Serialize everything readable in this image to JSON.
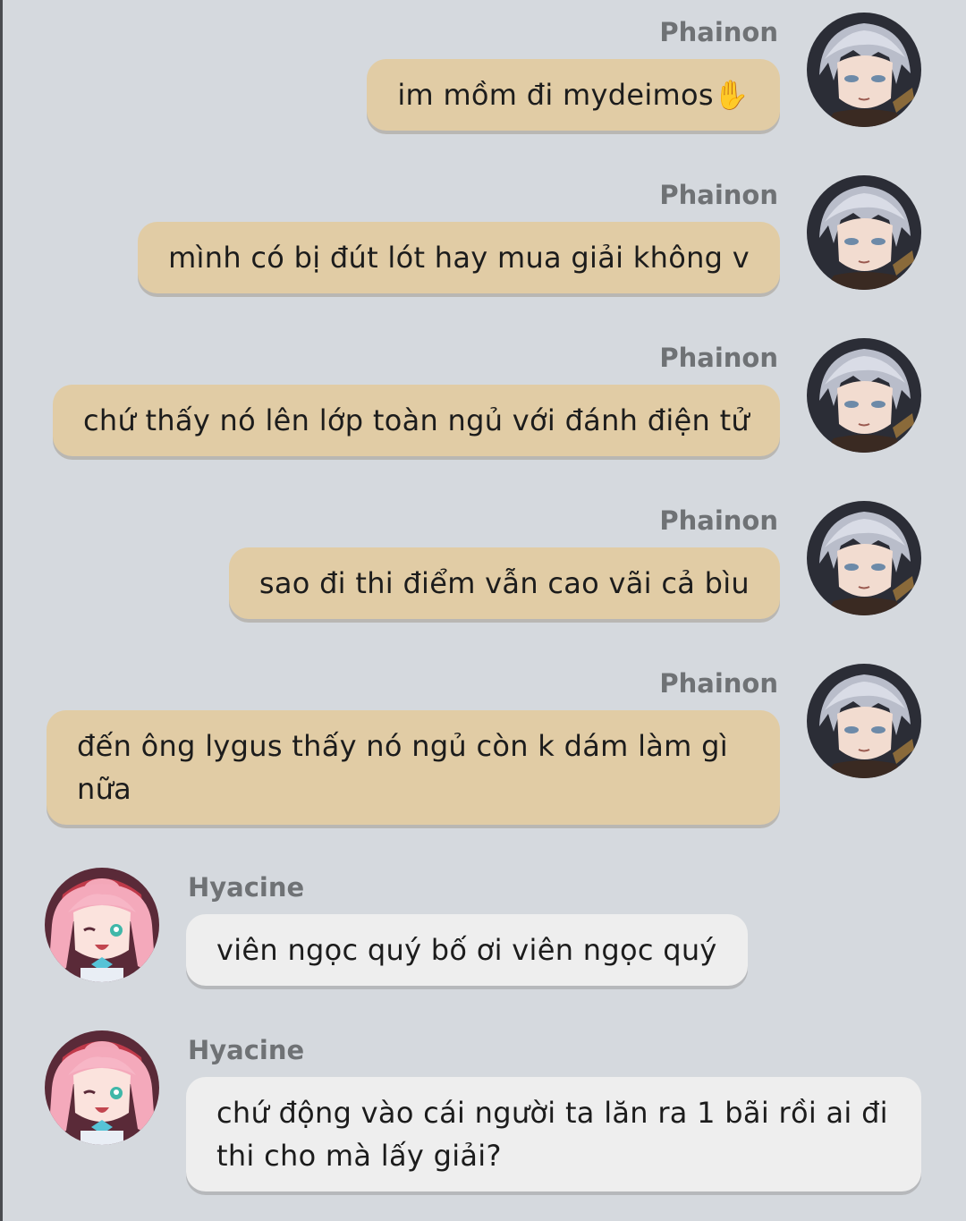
{
  "messages": [
    {
      "sender": "Phainon",
      "text": "im mồm đi mydeimos✋",
      "side": "right"
    },
    {
      "sender": "Phainon",
      "text": "mình có bị đút lót hay mua giải không v",
      "side": "right"
    },
    {
      "sender": "Phainon",
      "text": "chứ thấy nó lên lớp toàn ngủ với đánh điện tử",
      "side": "right"
    },
    {
      "sender": "Phainon",
      "text": "sao đi thi điểm vẫn cao vãi cả bìu",
      "side": "right"
    },
    {
      "sender": "Phainon",
      "text": "đến ông lygus thấy nó ngủ còn k dám làm gì nữa",
      "side": "right"
    },
    {
      "sender": "Hyacine",
      "text": "viên ngọc quý bố ơi viên ngọc quý",
      "side": "left"
    },
    {
      "sender": "Hyacine",
      "text": "chứ động vào cái người ta lăn ra 1 bãi rồi ai đi thi cho mà lấy giải?",
      "side": "left"
    }
  ],
  "avatars": {
    "phainon": "phainon-avatar",
    "hyacine": "hyacine-avatar"
  },
  "colors": {
    "background": "#d5d9de",
    "right_bubble": "#e1cca5",
    "left_bubble": "#eeeeee",
    "sender_name": "#6f7275"
  }
}
